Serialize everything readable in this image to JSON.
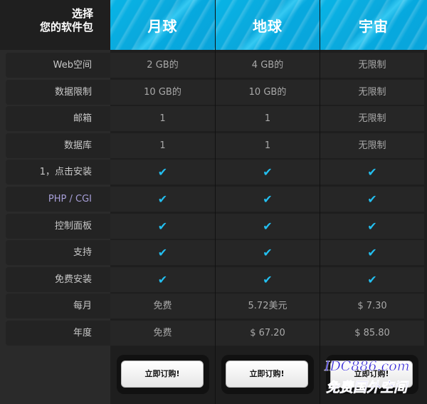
{
  "header": {
    "title_line1": "选择",
    "title_line2": "您的软件包",
    "plans": [
      "月球",
      "地球",
      "宇宙"
    ]
  },
  "rows": [
    {
      "label": "Web空间",
      "values": [
        "2 GB的",
        "4 GB的",
        "无限制"
      ]
    },
    {
      "label": "数据限制",
      "values": [
        "10 GB的",
        "10 GB的",
        "无限制"
      ]
    },
    {
      "label": "邮箱",
      "values": [
        "1",
        "1",
        "无限制"
      ]
    },
    {
      "label": "数据库",
      "values": [
        "1",
        "1",
        "无限制"
      ]
    },
    {
      "label": "1，点击安装",
      "values": [
        "✔",
        "✔",
        "✔"
      ]
    },
    {
      "label": "PHP / CGI",
      "values": [
        "✔",
        "✔",
        "✔"
      ]
    },
    {
      "label": "控制面板",
      "values": [
        "✔",
        "✔",
        "✔"
      ]
    },
    {
      "label": "支持",
      "values": [
        "✔",
        "✔",
        "✔"
      ]
    },
    {
      "label": "免费安装",
      "values": [
        "✔",
        "✔",
        "✔"
      ]
    },
    {
      "label": "每月",
      "values": [
        "免费",
        "5.72美元",
        "$ 7.30"
      ]
    },
    {
      "label": "年度",
      "values": [
        "免费",
        "$ 67.20",
        "$ 85.80"
      ]
    }
  ],
  "buttons": [
    "立即订购!",
    "立即订购!",
    "立即订购!"
  ],
  "watermark": {
    "line1": "IDC886.com",
    "line2": "免费国外空间"
  },
  "colors": {
    "accent": "#0aa8dc",
    "check": "#23bff0"
  }
}
